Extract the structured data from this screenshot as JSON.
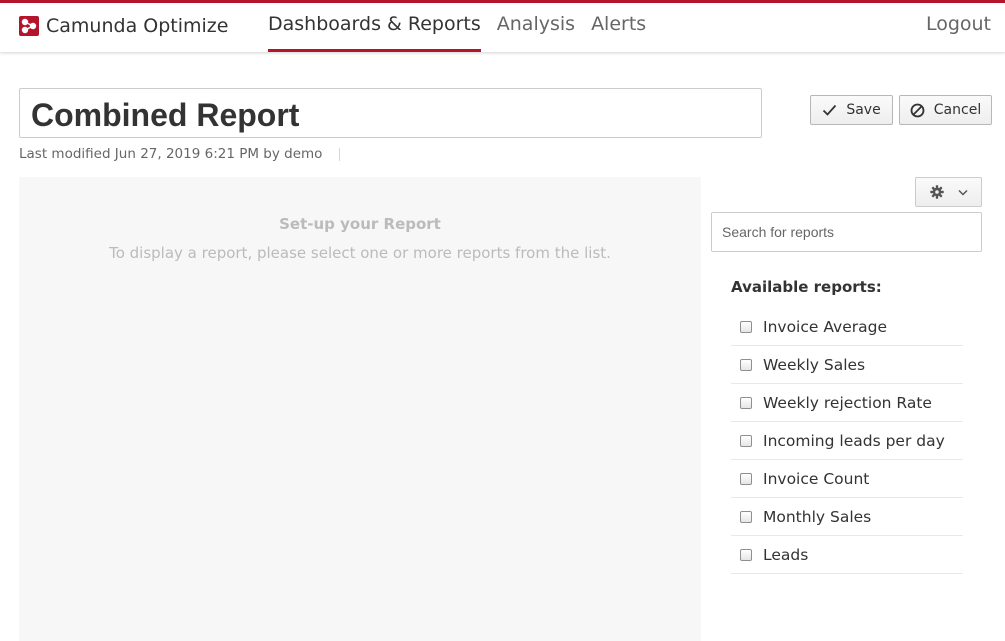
{
  "header": {
    "brand_name": "Camunda Optimize",
    "nav": [
      {
        "label": "Dashboards & Reports",
        "active": true
      },
      {
        "label": "Analysis",
        "active": false
      },
      {
        "label": "Alerts",
        "active": false
      }
    ],
    "logout_label": "Logout"
  },
  "report": {
    "title": "Combined Report",
    "last_modified": "Last modified Jun 27, 2019 6:21 PM by demo"
  },
  "toolbar": {
    "save_label": "Save",
    "cancel_label": "Cancel"
  },
  "empty_state": {
    "title": "Set-up your Report",
    "text": "To display a report, please select one or more reports from the list."
  },
  "panel": {
    "search_placeholder": "Search for reports",
    "available_label": "Available reports:",
    "reports": [
      {
        "name": "Invoice Average",
        "checked": false
      },
      {
        "name": "Weekly Sales",
        "checked": false
      },
      {
        "name": "Weekly rejection Rate",
        "checked": false
      },
      {
        "name": "Incoming leads per day",
        "checked": false
      },
      {
        "name": "Invoice Count",
        "checked": false
      },
      {
        "name": "Monthly Sales",
        "checked": false
      },
      {
        "name": "Leads",
        "checked": false
      }
    ]
  },
  "colors": {
    "accent": "#b5152b",
    "empty_text": "#bbbbbb",
    "report_bg": "#f7f7f8"
  },
  "icons": {
    "brand": "camunda-logo-icon",
    "save": "check-icon",
    "cancel": "ban-icon",
    "settings": "gear-icon",
    "dropdown": "chevron-down-icon"
  }
}
